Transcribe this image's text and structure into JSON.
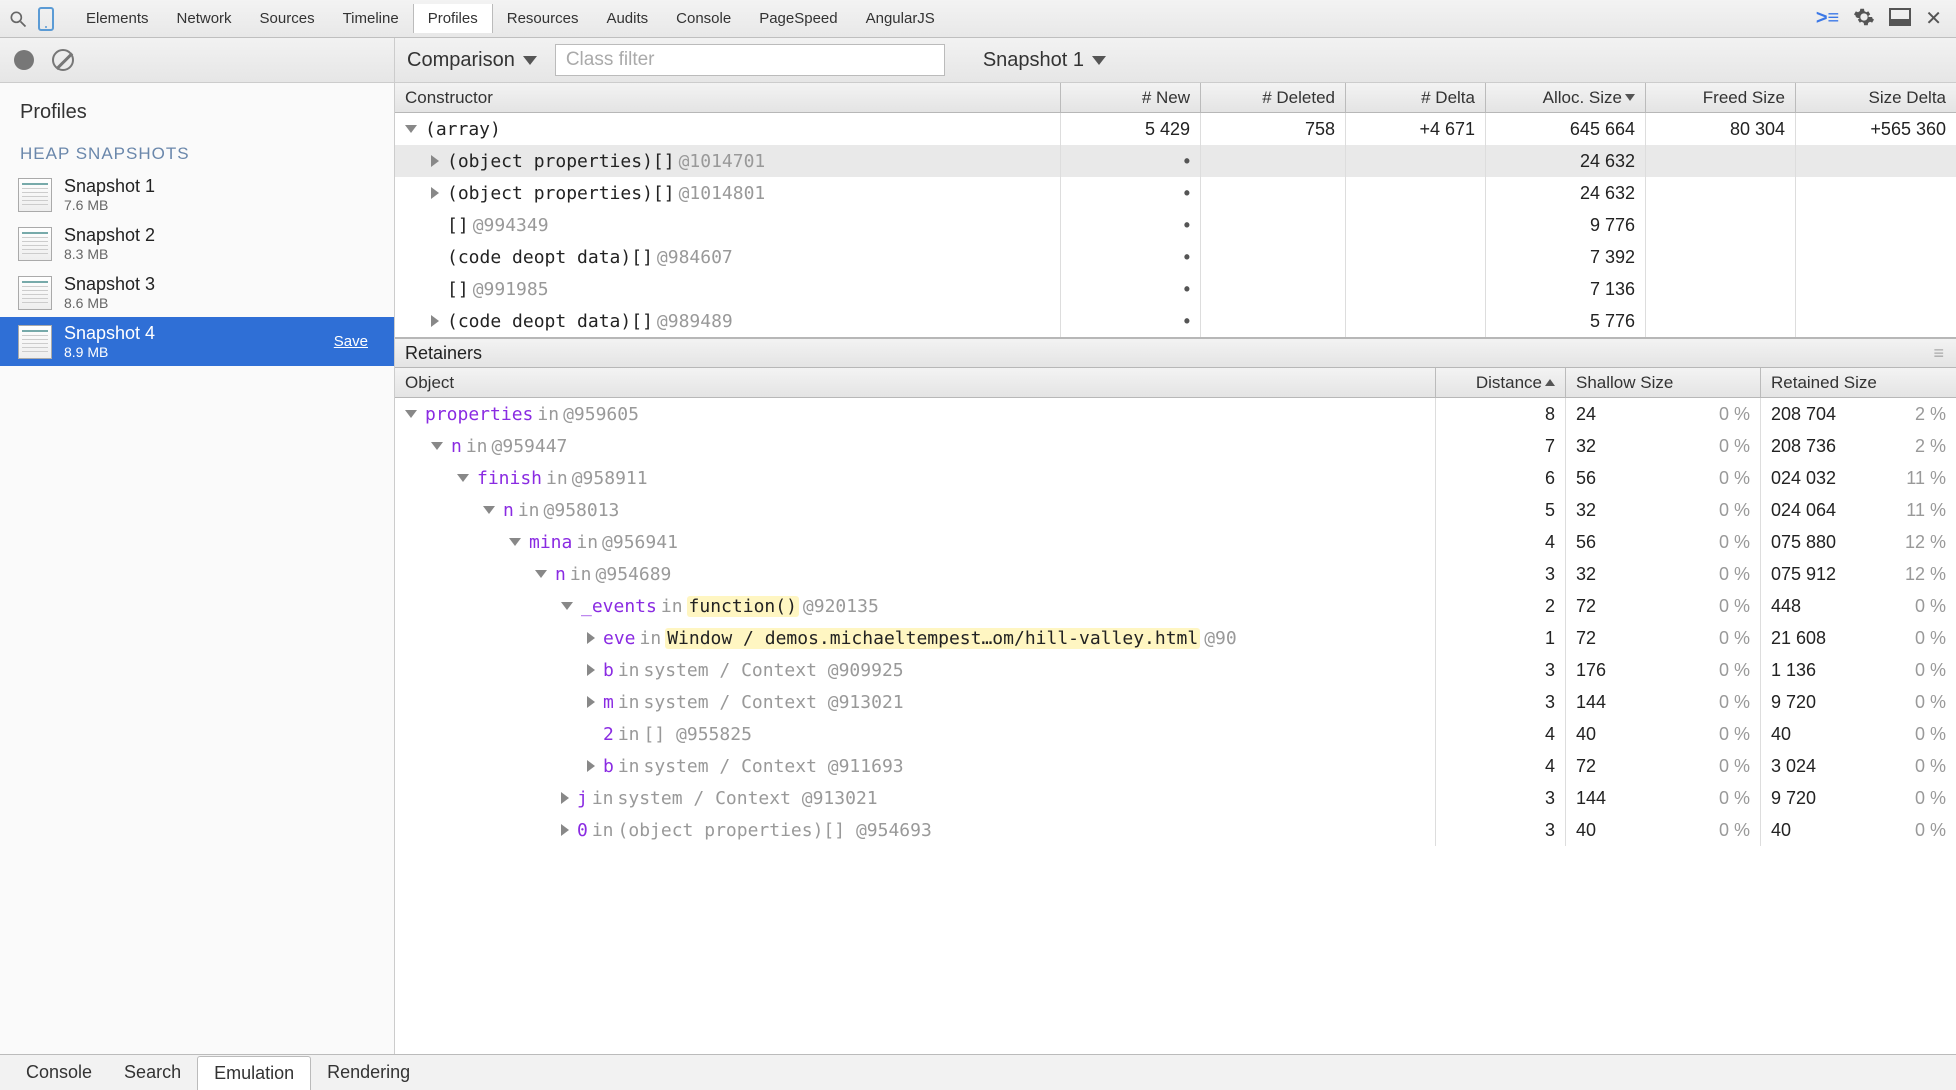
{
  "toolbar": {
    "tabs": [
      "Elements",
      "Network",
      "Sources",
      "Timeline",
      "Profiles",
      "Resources",
      "Audits",
      "Console",
      "PageSpeed",
      "AngularJS"
    ],
    "active": "Profiles"
  },
  "sidebar": {
    "title": "Profiles",
    "category": "HEAP SNAPSHOTS",
    "snapshots": [
      {
        "name": "Snapshot 1",
        "size": "7.6 MB",
        "selected": false,
        "save": false
      },
      {
        "name": "Snapshot 2",
        "size": "8.3 MB",
        "selected": false,
        "save": false
      },
      {
        "name": "Snapshot 3",
        "size": "8.6 MB",
        "selected": false,
        "save": false
      },
      {
        "name": "Snapshot 4",
        "size": "8.9 MB",
        "selected": true,
        "save": true
      }
    ],
    "save_label": "Save"
  },
  "panel_toolbar": {
    "view": "Comparison",
    "filter_placeholder": "Class filter",
    "baseline": "Snapshot 1"
  },
  "comparison": {
    "headers": {
      "constructor": "Constructor",
      "new": "# New",
      "deleted": "# Deleted",
      "delta": "# Delta",
      "alloc": "Alloc. Size",
      "freed": "Freed Size",
      "szdelta": "Size Delta"
    },
    "rows": [
      {
        "indent": 0,
        "arrow": "down",
        "label": "(array)",
        "id": "",
        "new": "5 429",
        "deleted": "758",
        "delta": "+4 671",
        "alloc": "645 664",
        "freed": "80 304",
        "szdelta": "+565 360",
        "shaded": false
      },
      {
        "indent": 1,
        "arrow": "right",
        "label": "(object properties)[]",
        "id": "@1014701",
        "new": "•",
        "deleted": "",
        "delta": "",
        "alloc": "24 632",
        "freed": "",
        "szdelta": "",
        "shaded": true
      },
      {
        "indent": 1,
        "arrow": "right",
        "label": "(object properties)[]",
        "id": "@1014801",
        "new": "•",
        "deleted": "",
        "delta": "",
        "alloc": "24 632",
        "freed": "",
        "szdelta": "",
        "shaded": false
      },
      {
        "indent": 1,
        "arrow": "",
        "label": "[]",
        "id": "@994349",
        "new": "•",
        "deleted": "",
        "delta": "",
        "alloc": "9 776",
        "freed": "",
        "szdelta": "",
        "shaded": false
      },
      {
        "indent": 1,
        "arrow": "",
        "label": "(code deopt data)[]",
        "id": "@984607",
        "new": "•",
        "deleted": "",
        "delta": "",
        "alloc": "7 392",
        "freed": "",
        "szdelta": "",
        "shaded": false
      },
      {
        "indent": 1,
        "arrow": "",
        "label": "[]",
        "id": "@991985",
        "new": "•",
        "deleted": "",
        "delta": "",
        "alloc": "7 136",
        "freed": "",
        "szdelta": "",
        "shaded": false
      },
      {
        "indent": 1,
        "arrow": "right",
        "label": "(code deopt data)[]",
        "id": "@989489",
        "new": "•",
        "deleted": "",
        "delta": "",
        "alloc": "5 776",
        "freed": "",
        "szdelta": "",
        "shaded": false
      }
    ]
  },
  "retainers": {
    "title": "Retainers",
    "headers": {
      "object": "Object",
      "distance": "Distance",
      "shallow": "Shallow Size",
      "retained": "Retained Size"
    },
    "rows": [
      {
        "indent": 0,
        "arrow": "down",
        "pre": "",
        "name": "properties",
        "mid": " in ",
        "post": "@959605",
        "hl": "",
        "dist": "8",
        "sh": "24",
        "shp": "0 %",
        "ret": "208 704",
        "retp": "2 %"
      },
      {
        "indent": 1,
        "arrow": "down",
        "pre": "",
        "name": "n",
        "mid": " in ",
        "post": "@959447",
        "hl": "",
        "dist": "7",
        "sh": "32",
        "shp": "0 %",
        "ret": "208 736",
        "retp": "2 %"
      },
      {
        "indent": 2,
        "arrow": "down",
        "pre": "",
        "name": "finish",
        "mid": " in ",
        "post": "@958911",
        "hl": "",
        "dist": "6",
        "sh": "56",
        "shp": "0 %",
        "ret": "024 032",
        "retp": "11 %"
      },
      {
        "indent": 3,
        "arrow": "down",
        "pre": "",
        "name": "n",
        "mid": " in ",
        "post": "@958013",
        "hl": "",
        "dist": "5",
        "sh": "32",
        "shp": "0 %",
        "ret": "024 064",
        "retp": "11 %"
      },
      {
        "indent": 4,
        "arrow": "down",
        "pre": "",
        "name": "mina",
        "mid": " in ",
        "post": "@956941",
        "hl": "",
        "dist": "4",
        "sh": "56",
        "shp": "0 %",
        "ret": "075 880",
        "retp": "12 %"
      },
      {
        "indent": 5,
        "arrow": "down",
        "pre": "",
        "name": "n",
        "mid": " in ",
        "post": "@954689",
        "hl": "",
        "dist": "3",
        "sh": "32",
        "shp": "0 %",
        "ret": "075 912",
        "retp": "12 %"
      },
      {
        "indent": 6,
        "arrow": "down",
        "pre": "",
        "name": "_events",
        "mid": " in ",
        "post": " @920135",
        "hl": "function()",
        "dist": "2",
        "sh": "72",
        "shp": "0 %",
        "ret": "448",
        "retp": "0 %"
      },
      {
        "indent": 7,
        "arrow": "right",
        "pre": "",
        "name": "eve",
        "mid": " in ",
        "post": " @90",
        "hl": "Window / demos.michaeltempest…om/hill-valley.html",
        "dist": "1",
        "sh": "72",
        "shp": "0 %",
        "ret": "21 608",
        "retp": "0 %"
      },
      {
        "indent": 7,
        "arrow": "right",
        "pre": "",
        "name": "b",
        "mid": " in ",
        "post": "system / Context @909925",
        "hl": "",
        "dist": "3",
        "sh": "176",
        "shp": "0 %",
        "ret": "1 136",
        "retp": "0 %"
      },
      {
        "indent": 7,
        "arrow": "right",
        "pre": "",
        "name": "m",
        "mid": " in ",
        "post": "system / Context @913021",
        "hl": "",
        "dist": "3",
        "sh": "144",
        "shp": "0 %",
        "ret": "9 720",
        "retp": "0 %"
      },
      {
        "indent": 7,
        "arrow": "",
        "pre": "",
        "name": "2",
        "mid": " in ",
        "post": "[] @955825",
        "hl": "",
        "dist": "4",
        "sh": "40",
        "shp": "0 %",
        "ret": "40",
        "retp": "0 %"
      },
      {
        "indent": 7,
        "arrow": "right",
        "pre": "",
        "name": "b",
        "mid": " in ",
        "post": "system / Context @911693",
        "hl": "",
        "dist": "4",
        "sh": "72",
        "shp": "0 %",
        "ret": "3 024",
        "retp": "0 %"
      },
      {
        "indent": 6,
        "arrow": "right",
        "pre": "",
        "name": "j",
        "mid": " in ",
        "post": "system / Context @913021",
        "hl": "",
        "dist": "3",
        "sh": "144",
        "shp": "0 %",
        "ret": "9 720",
        "retp": "0 %"
      },
      {
        "indent": 6,
        "arrow": "right",
        "pre": "",
        "name": "0",
        "mid": " in ",
        "post": "(object properties)[] @954693",
        "hl": "",
        "dist": "3",
        "sh": "40",
        "shp": "0 %",
        "ret": "40",
        "retp": "0 %"
      }
    ]
  },
  "bottom": {
    "tabs": [
      "Console",
      "Search",
      "Emulation",
      "Rendering"
    ],
    "active": "Emulation"
  }
}
